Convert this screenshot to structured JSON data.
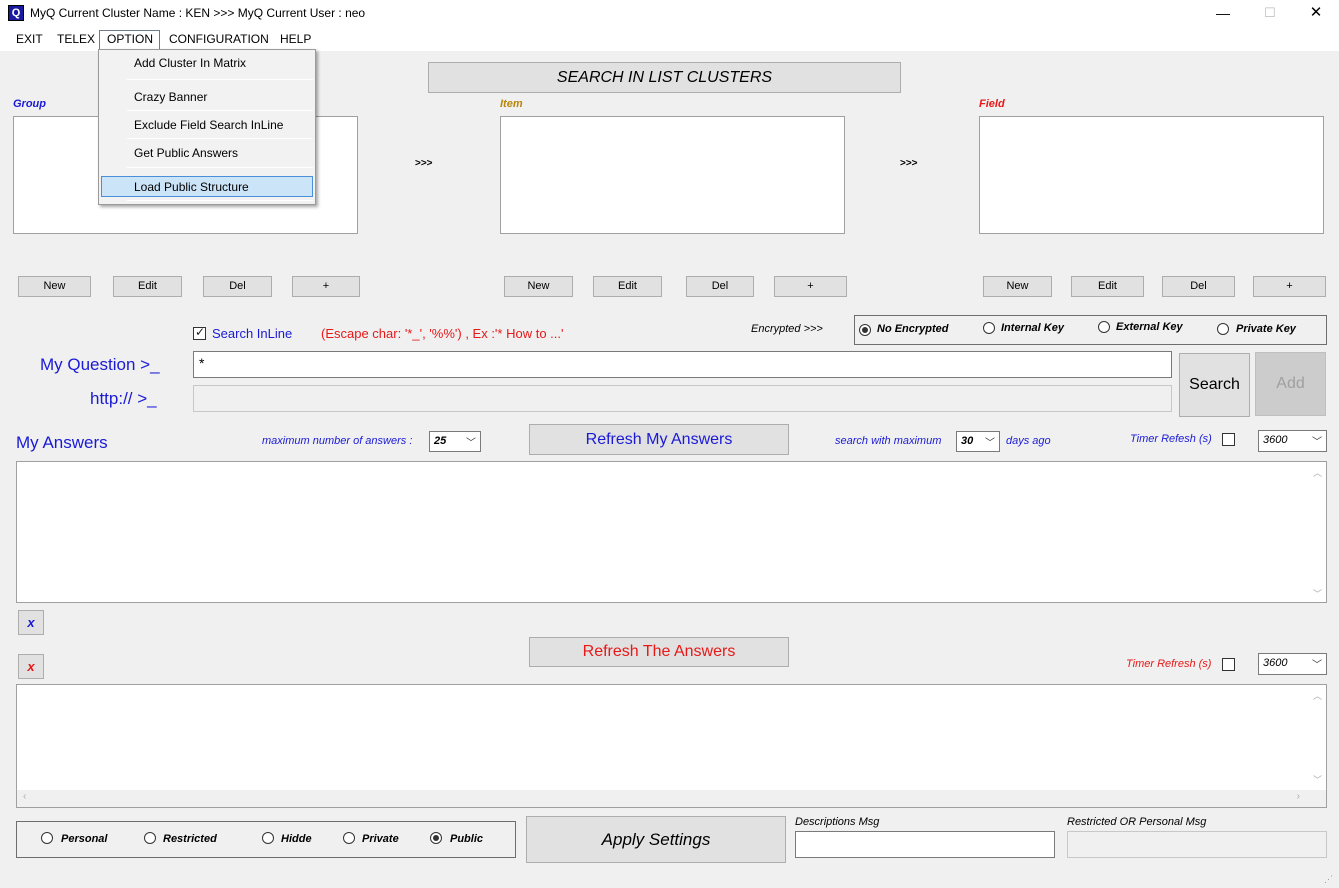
{
  "window": {
    "title": "MyQ Current Cluster Name : KEN >>> MyQ Current User : neo",
    "icon_letter": "Q",
    "minimize": "—",
    "maximize": "☐",
    "close": "✕"
  },
  "menu": {
    "items": [
      "EXIT",
      "TELEX",
      "OPTION",
      "CONFIGURATION",
      "HELP"
    ],
    "dropdown": [
      "Add Cluster In Matrix",
      "Crazy Banner",
      "Exclude Field Search InLine",
      "Get Public Answers",
      "Load Public Structure"
    ]
  },
  "search_banner": "SEARCH IN LIST CLUSTERS",
  "lists": {
    "group_label": "Group",
    "item_label": "Item",
    "field_label": "Field",
    "arrow": ">>>"
  },
  "list_buttons": {
    "new": "New",
    "edit": "Edit",
    "del": "Del",
    "plus": "+"
  },
  "search_inline": {
    "label": "Search InLine",
    "hint": "(Escape char: '*_', '%%') , Ex :'* How to ...'",
    "checked": true
  },
  "encryption": {
    "label": "Encrypted >>>",
    "options": [
      "No Encrypted",
      "Internal Key",
      "External Key",
      "Private Key"
    ],
    "selected": "No Encrypted"
  },
  "question": {
    "label": "My Question >_",
    "value": "*",
    "url_label": "http:// >_",
    "url_value": ""
  },
  "actions": {
    "search": "Search",
    "add": "Add"
  },
  "my_answers": {
    "title": "My Answers",
    "max_label": "maximum number of answers :",
    "max_value": "25",
    "refresh": "Refresh My Answers",
    "days_label": "search with maximum",
    "days_value": "30",
    "days_suffix": "days ago",
    "timer_label": "Timer Refesh (s)",
    "timer_value": "3600"
  },
  "answers": {
    "clear_blue": "x",
    "clear_red": "x",
    "refresh": "Refresh The Answers",
    "timer_label": "Timer Refresh (s)",
    "timer_value": "3600"
  },
  "visibility": {
    "options": [
      "Personal",
      "Restricted",
      "Hidde",
      "Private",
      "Public"
    ],
    "selected": "Public"
  },
  "apply": "Apply Settings",
  "descriptions_label": "Descriptions Msg",
  "restricted_label": "Restricted OR Personal Msg",
  "colors": {
    "blue": "#1a1ad6",
    "red": "#e81818",
    "gold": "#b8860b",
    "highlight": "#cce4f7"
  }
}
